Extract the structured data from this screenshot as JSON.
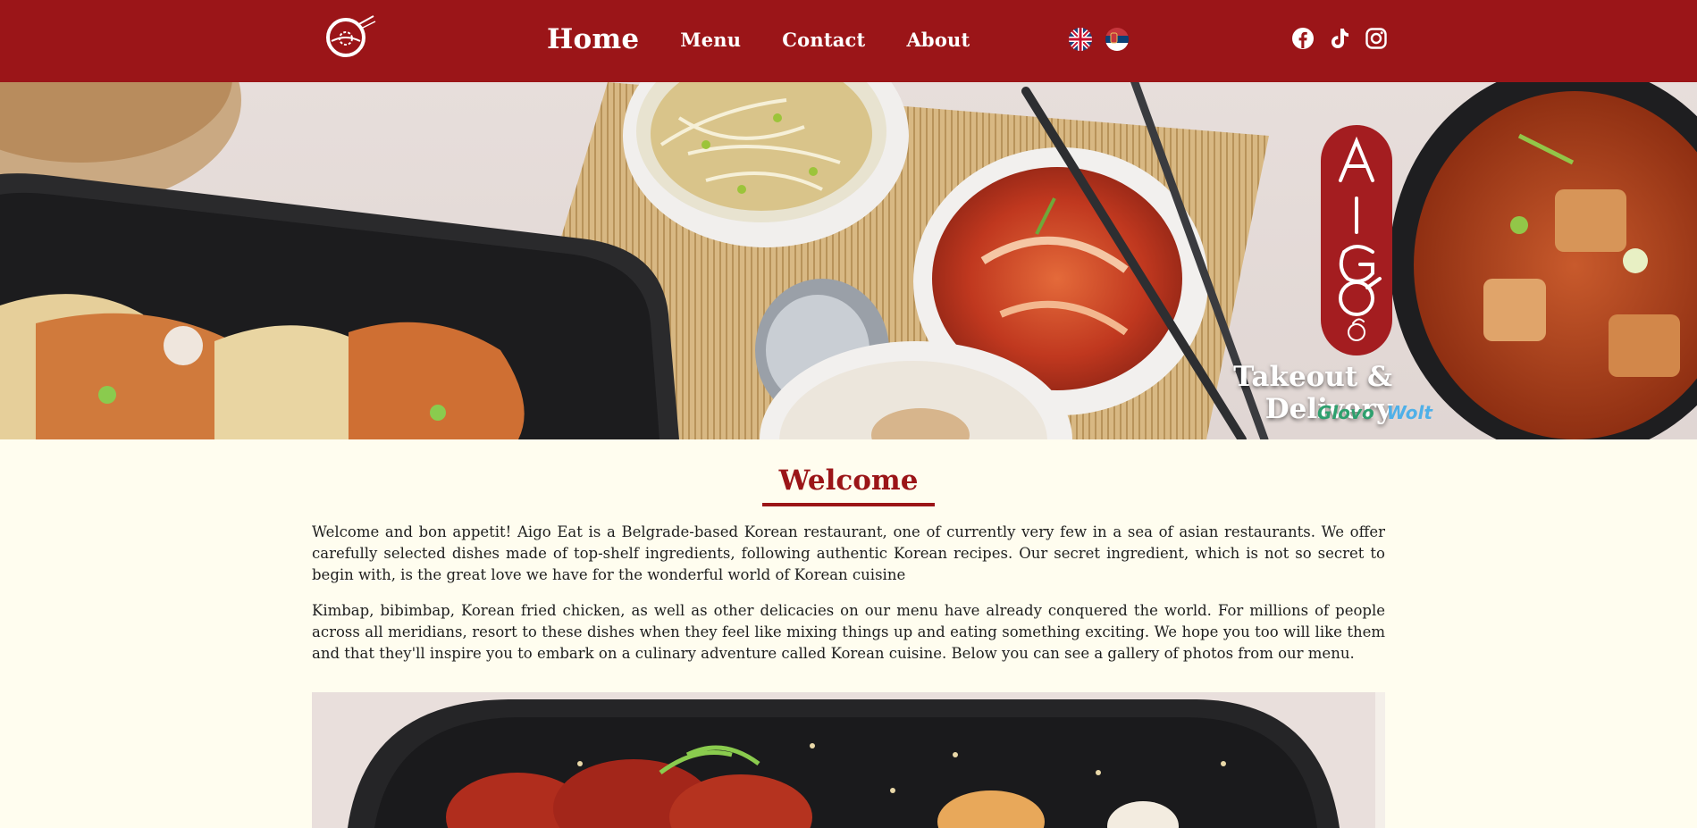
{
  "nav": {
    "links": [
      {
        "label": "Home",
        "active": true
      },
      {
        "label": "Menu",
        "active": false
      },
      {
        "label": "Contact",
        "active": false
      },
      {
        "label": "About",
        "active": false
      }
    ],
    "languages": [
      "English flag",
      "Serbian flag"
    ],
    "social": [
      "facebook-icon",
      "tiktok-icon",
      "instagram-icon"
    ]
  },
  "hero": {
    "brand_letters": "AIGO",
    "takeout_title": "Takeout & Delivery",
    "delivery_partners": [
      "Glovo",
      "Wolt"
    ]
  },
  "welcome": {
    "title": "Welcome",
    "paragraphs": [
      "Welcome and bon appetit! Aigo Eat is a Belgrade-based Korean restaurant, one of currently very few in a sea of asian restaurants. We offer carefully selected dishes made of top-shelf ingredients, following authentic Korean recipes. Our secret ingredient, which is not so secret to begin with, is the great love we have for the wonderful world of Korean cuisine",
      "Kimbap, bibimbap, Korean fried chicken, as well as other delicacies on our menu have already conquered the world. For millions of people across all meridians, resort to these dishes when they feel like mixing things up and eating something exciting. We hope you too will like them and that they'll inspire you to embark on a culinary adventure called Korean cuisine. Below you can see a gallery of photos from our menu."
    ]
  },
  "colors": {
    "brand_red": "#9b1518",
    "page_bg": "#fffdef",
    "text": "#1e1e1e"
  }
}
